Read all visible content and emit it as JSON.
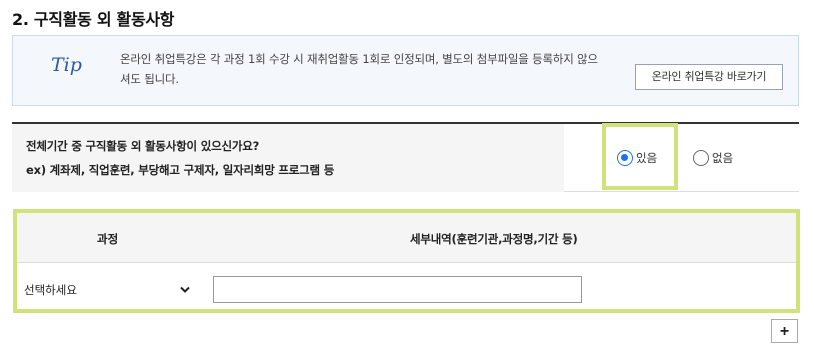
{
  "section": {
    "title": "2. 구직활동 외 활동사항"
  },
  "tip": {
    "label": "Tip",
    "text": "온라인 취업특강은 각 과정 1회 수강 시 재취업활동 1회로 인정되며, 별도의 첨부파일을 등록하지 않으셔도 됩니다.",
    "button_label": "온라인 취업특강 바로가기"
  },
  "question": {
    "line1": "전체기간 중 구직활동 외 활동사항이 있으신가요?",
    "line2": "ex) 계좌제, 직업훈련, 부당해고 구제자, 일자리희망 프로그램 등",
    "options": [
      {
        "label": "있음",
        "checked": true
      },
      {
        "label": "없음",
        "checked": false
      }
    ]
  },
  "table": {
    "headers": {
      "course": "과정",
      "detail": "세부내역(훈련기관,과정명,기간 등)"
    },
    "row": {
      "select_value": "선택하세요",
      "detail_value": ""
    }
  },
  "add_button_label": "+",
  "colors": {
    "highlight": "#cfe37a",
    "radio_checked": "#1a73e8",
    "tip_accent": "#2a5aa8"
  }
}
